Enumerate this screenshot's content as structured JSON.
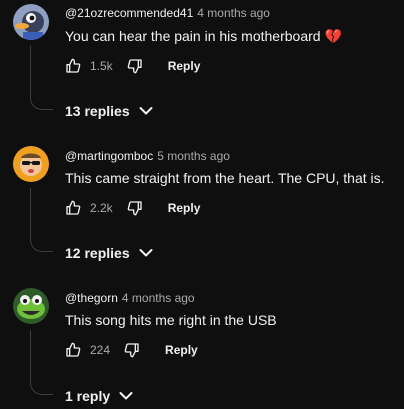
{
  "comments": [
    {
      "handle": "@21ozrecommended41",
      "time": "4 months ago",
      "text": "You can hear the pain in his motherboard",
      "emoji": "💔",
      "likes": "1.5k",
      "reply_label": "Reply",
      "replies_label": "13 replies",
      "avatar": "duck-avatar"
    },
    {
      "handle": "@martingomboc",
      "time": "5 months ago",
      "text": "This came straight from the heart. The CPU, that is.",
      "likes": "2.2k",
      "reply_label": "Reply",
      "replies_label": "12 replies",
      "avatar": "sunglasses-face-avatar"
    },
    {
      "handle": "@thegorn",
      "time": "4 months ago",
      "text": "This song hits me right in the USB",
      "likes": "224",
      "reply_label": "Reply",
      "replies_label": "1 reply",
      "avatar": "frog-avatar"
    }
  ],
  "colors": {
    "background": "#0f0f0f",
    "text": "#f1f1f1",
    "muted": "#aaaaaa",
    "thread_line": "#3d3d3d"
  }
}
